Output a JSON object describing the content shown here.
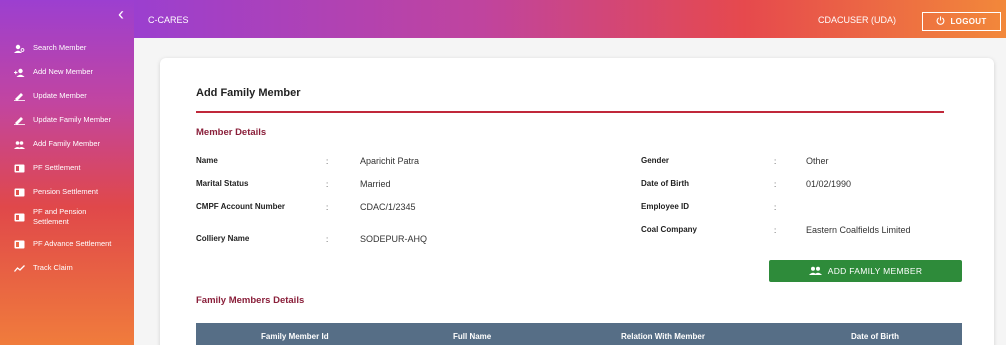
{
  "topbar": {
    "app_title": "C-CARES",
    "user": "CDACUSER (UDA)",
    "logout_label": "LOGOUT"
  },
  "sidebar": {
    "collapse_icon": "chevron-left-icon",
    "items": [
      {
        "label": "Search Member",
        "icon": "person-search-icon"
      },
      {
        "label": "Add New Member",
        "icon": "person-add-icon"
      },
      {
        "label": "Update Member",
        "icon": "pencil-icon"
      },
      {
        "label": "Update Family Member",
        "icon": "pencil-icon"
      },
      {
        "label": "Add Family Member",
        "icon": "people-icon"
      },
      {
        "label": "PF Settlement",
        "icon": "receipt-icon"
      },
      {
        "label": "Pension Settlement",
        "icon": "receipt-icon"
      },
      {
        "label": "PF and Pension Settlement",
        "icon": "receipt-icon"
      },
      {
        "label": "PF Advance Settlement",
        "icon": "receipt-icon"
      },
      {
        "label": "Track Claim",
        "icon": "trending-icon"
      }
    ]
  },
  "main": {
    "title": "Add Family Member",
    "member_section": "Member Details",
    "fields": {
      "name": {
        "label": "Name",
        "value": "Aparichit Patra"
      },
      "marital": {
        "label": "Marital Status",
        "value": "Married"
      },
      "cmpf": {
        "label": "CMPF Account Number",
        "value": "CDAC/1/2345"
      },
      "colliery": {
        "label": "Colliery Name",
        "value": "SODEPUR-AHQ"
      },
      "gender": {
        "label": "Gender",
        "value": "Other"
      },
      "dob": {
        "label": "Date of Birth",
        "value": "01/02/1990"
      },
      "empid": {
        "label": "Employee ID",
        "value": ""
      },
      "company": {
        "label": "Coal Company",
        "value": "Eastern Coalfields Limited"
      }
    },
    "add_button": "ADD FAMILY MEMBER",
    "family_section": "Family Members Details",
    "table_headers": [
      "Family Member Id",
      "Full Name",
      "Relation With Member",
      "Date of Birth"
    ]
  },
  "colors": {
    "accent": "#8a1f3a",
    "divider": "#c0283a",
    "button": "#2e8b3a",
    "table_header": "#566e86"
  }
}
